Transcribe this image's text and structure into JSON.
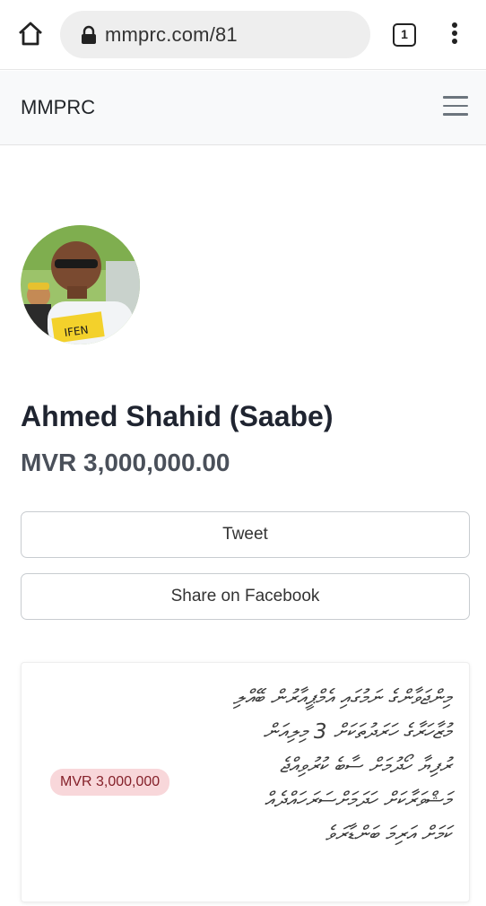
{
  "browser": {
    "url": "mmprc.com/81",
    "tab_count": "1",
    "icons": [
      "home-icon",
      "lock-icon",
      "tabs-icon",
      "more-vert-icon"
    ]
  },
  "navbar": {
    "brand": "MMPRC",
    "menu_icon": "hamburger-icon"
  },
  "profile": {
    "name": "Ahmed Shahid (Saabe)",
    "amount": "MVR 3,000,000.00"
  },
  "actions": {
    "tweet": "Tweet",
    "share_facebook": "Share on Facebook"
  },
  "card": {
    "badge": "MVR 3,000,000",
    "lines": [
      "މިންޖަވާންގެ ނަމުގައި އެމްޕީއާރުން ބޭއްލި",
      "މުޒާހަރާގެ ހަރަދުތަކަށް 3 މިލިއަން",
      "ރުފިޔާ ހޯދުމަށް ސާބެ ކުރުވިއްޖެ",
      "މަޝްވަރާކަށް ހަދަމަށްސަރަހައްދެއް",
      "ކަމަށް އަރިމަ ބަންޑާރަވެ"
    ]
  },
  "colors": {
    "navbar_bg": "#f8f9fa",
    "badge_bg": "#f8d7da",
    "badge_text": "#842029"
  }
}
